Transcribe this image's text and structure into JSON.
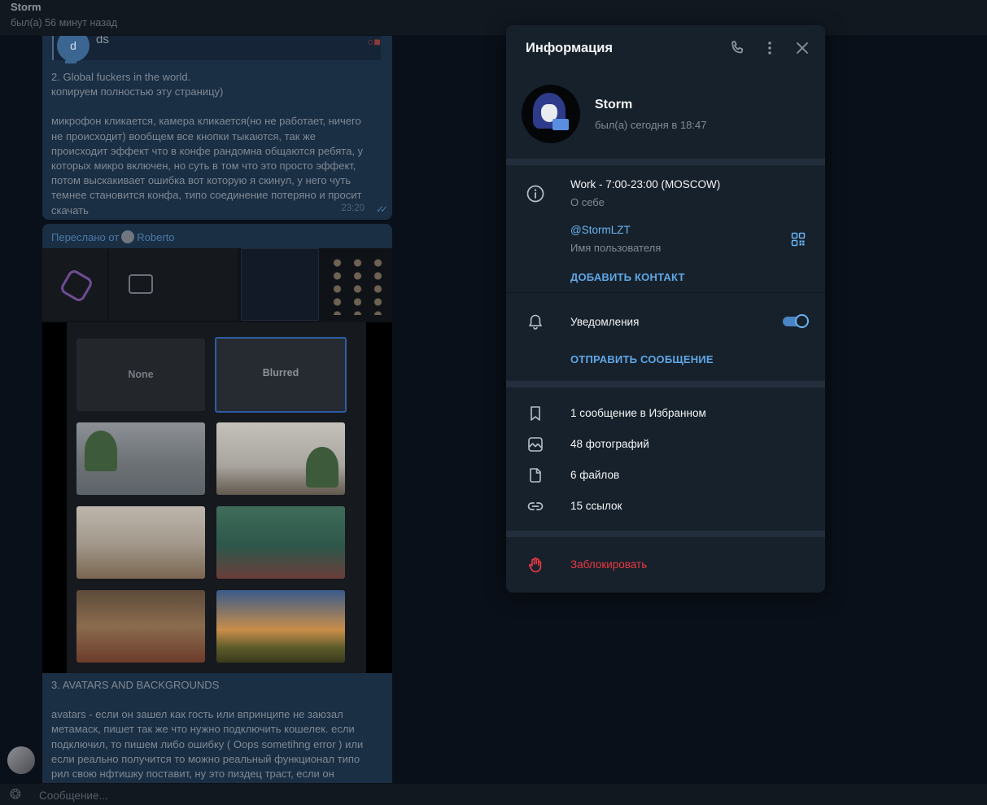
{
  "header": {
    "name": "Storm",
    "status": "был(а) 56 минут назад"
  },
  "chat": {
    "quoted": {
      "avatar_letter": "d",
      "name": "ds"
    },
    "message2": {
      "lines_a": [
        "2. Global fuckers in the world.",
        "копируем полностью эту страницу)"
      ],
      "lines_b": [
        "микрофон кликается, камера кликается(но не работает, ничего",
        "не происходит) вообщем все кнопки тыкаются, так же",
        "происходит эффект что в конфе рандомна общаются ребята, у",
        "которых микро включен, но суть в том что это просто эффект,",
        "потом выскакивает ошибка вот которую я скинул, у него чуть",
        "темнее становится конфа, типо соединение потеряно и просит",
        "скачать"
      ],
      "time": "23:20"
    },
    "forwarded": {
      "label": "Переслано от",
      "from": "Roberto"
    },
    "gallery": {
      "none_label": "None",
      "blurred_label": "Blurred"
    },
    "message3": {
      "line_a": "3. AVATARS AND BACKGROUNDS",
      "lines_b": [
        "avatars - если он зашел как гость или впринципе не заюзал",
        "метамаск, пишет так же что нужно подключить кошелек. если",
        "подключил, то пишем либо ошибку ( Oops sometihng error ) или",
        "если реально получится то можно реальный функционал типо",
        "рил свою нфтишку поставит, ну это пиздец траст, если он"
      ]
    }
  },
  "composer": {
    "placeholder": "Сообщение..."
  },
  "panel": {
    "title": "Информация",
    "profile": {
      "name": "Storm",
      "status": "был(а) сегодня в 18:47"
    },
    "bio": {
      "value": "Work - 7:00-23:00 (MOSCOW)",
      "label": "О себе"
    },
    "username": {
      "value": "@StormLZT",
      "label": "Имя пользователя"
    },
    "add_contact": "ДОБАВИТЬ КОНТАКТ",
    "notifications": {
      "label": "Уведомления",
      "enabled": true
    },
    "send_message": "ОТПРАВИТЬ СООБЩЕНИЕ",
    "media": [
      {
        "icon": "bookmark-icon",
        "label": "1 сообщение в Избранном"
      },
      {
        "icon": "photo-icon",
        "label": "48 фотографий"
      },
      {
        "icon": "file-icon",
        "label": "6 файлов"
      },
      {
        "icon": "link-icon",
        "label": "15 ссылок"
      }
    ],
    "block": "Заблокировать"
  },
  "colors": {
    "accent": "#6ab3f3",
    "danger": "#ec3942",
    "panel_bg": "#17212b"
  }
}
